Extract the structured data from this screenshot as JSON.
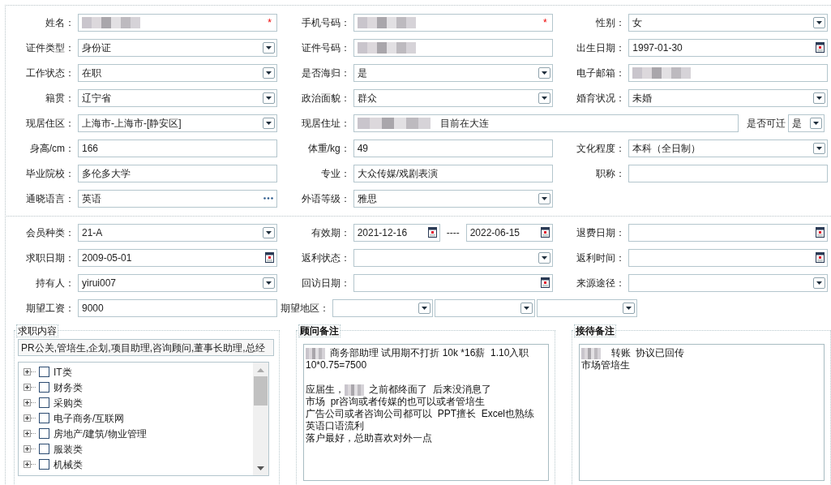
{
  "personal_rows": [
    [
      {
        "label": "姓名：",
        "kind": "text",
        "redacted": true,
        "required_mark": "*"
      },
      {
        "label": "手机号码：",
        "kind": "text",
        "redacted": true,
        "required_mark": "*"
      },
      {
        "label": "性别：",
        "kind": "select",
        "value": "女"
      }
    ],
    [
      {
        "label": "证件类型：",
        "kind": "select",
        "value": "身份证"
      },
      {
        "label": "证件号码：",
        "kind": "text",
        "redacted": true
      },
      {
        "label": "出生日期：",
        "kind": "date",
        "value": "1997-01-30"
      }
    ],
    [
      {
        "label": "工作状态：",
        "kind": "select",
        "value": "在职"
      },
      {
        "label": "是否海归：",
        "kind": "select",
        "value": "是"
      },
      {
        "label": "电子邮箱：",
        "kind": "text",
        "redacted": true
      }
    ],
    [
      {
        "label": "籍贯：",
        "kind": "select",
        "value": "辽宁省"
      },
      {
        "label": "政治面貌：",
        "kind": "select",
        "value": "群众"
      },
      {
        "label": "婚育状况：",
        "kind": "select",
        "value": "未婚"
      }
    ],
    [
      {
        "label": "现居住区：",
        "kind": "select",
        "value": "上海市-上海市-[静安区]"
      },
      {
        "label": "现居住址：",
        "kind": "wide_text",
        "redacted": true,
        "value": "目前在大连"
      },
      {
        "label": "是否可迁",
        "kind": "compact_select",
        "value": "是"
      }
    ],
    [
      {
        "label": "身高/cm：",
        "kind": "text",
        "value": "166"
      },
      {
        "label": "体重/kg：",
        "kind": "text",
        "value": "49"
      },
      {
        "label": "文化程度：",
        "kind": "select",
        "value": "本科（全日制）"
      }
    ],
    [
      {
        "label": "毕业院校：",
        "kind": "text",
        "value": "多伦多大学"
      },
      {
        "label": "专业：",
        "kind": "text",
        "value": "大众传媒/戏剧表演"
      },
      {
        "label": "职称：",
        "kind": "text"
      }
    ],
    [
      {
        "label": "通晓语言：",
        "kind": "picker",
        "value": "英语"
      },
      {
        "label": "外语等级：",
        "kind": "select",
        "value": "雅思"
      }
    ]
  ],
  "membership_rows": [
    [
      {
        "label": "会员种类：",
        "kind": "select",
        "value": "21-A"
      },
      {
        "label": "有效期：",
        "kind": "date_range",
        "values": [
          "2021-12-16",
          "2022-06-15"
        ],
        "separator": "----"
      },
      {
        "label": "退费日期：",
        "kind": "date"
      }
    ],
    [
      {
        "label": "求职日期：",
        "kind": "date",
        "value": "2009-05-01"
      },
      {
        "label": "返利状态：",
        "kind": "select"
      },
      {
        "label": "返利时间：",
        "kind": "date"
      }
    ],
    [
      {
        "label": "持有人：",
        "kind": "select",
        "value": "yirui007"
      },
      {
        "label": "回访日期：",
        "kind": "date"
      },
      {
        "label": "来源途径：",
        "kind": "select"
      }
    ],
    [
      {
        "label": "期望工资：",
        "kind": "text",
        "value": "9000"
      },
      {
        "label": "期望地区：",
        "kind": "multi_select",
        "selects": [
          {
            "kind": "select"
          },
          {
            "kind": "select"
          },
          {
            "kind": "select"
          }
        ]
      }
    ]
  ],
  "job_content": {
    "legend": "求职内容",
    "bold": false,
    "value": "PR公关,管培生,企划,项目助理,咨询顾问,董事长助理,总经",
    "tree": [
      {
        "label": "IT类",
        "checked": false,
        "expanded": false
      },
      {
        "label": "财务类",
        "checked": false,
        "expanded": false
      },
      {
        "label": "采购类",
        "checked": false,
        "expanded": false
      },
      {
        "label": "电子商务/互联网",
        "checked": false,
        "expanded": false
      },
      {
        "label": "房地产/建筑/物业管理",
        "checked": false,
        "expanded": false
      },
      {
        "label": "服装类",
        "checked": false,
        "expanded": false
      },
      {
        "label": "机械类",
        "checked": false,
        "expanded": false
      }
    ]
  },
  "notes": [
    {
      "legend": "顾问备注",
      "bold": true,
      "lines": [
        {
          "kind": "redacted",
          "after": "商务部助理 试用期不打折 10k *16薪  1.10入职"
        },
        {
          "kind": "text",
          "text": "10*0.75=7500"
        },
        {
          "kind": "blank"
        },
        {
          "kind": "redacted",
          "before": "应届生，",
          "after": "之前都终面了  后来没消息了"
        },
        {
          "kind": "text",
          "text": "市场  pr咨询或者传媒的也可以或者管培生"
        },
        {
          "kind": "text",
          "text": "广告公司或者咨询公司都可以  PPT擅长  Excel也熟练"
        },
        {
          "kind": "text",
          "text": "英语口语流利"
        },
        {
          "kind": "text",
          "text": "落户最好，总助喜欢对外一点"
        }
      ]
    },
    {
      "legend": "接待备注",
      "bold": true,
      "lines": [
        {
          "kind": "redacted",
          "after": "  转账  协议已回传"
        },
        {
          "kind": "text",
          "text": "市场管培生"
        }
      ]
    }
  ]
}
